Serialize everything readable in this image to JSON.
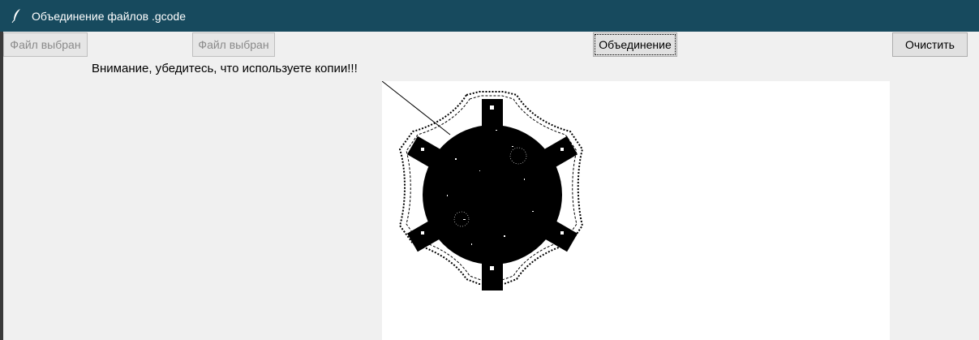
{
  "window": {
    "title": "Объединение файлов .gcode",
    "icon": "feather-icon"
  },
  "toolbar": {
    "file1_label": "Файл выбран",
    "file2_label": "Файл выбран",
    "merge_label": "Объединение",
    "clear_label": "Очистить"
  },
  "warning_text": "Внимание, убедитесь, что используете копии!!!",
  "preview": {
    "content": "gcode-toolpath-gear"
  },
  "colors": {
    "titlebar": "#174a5e",
    "background": "#f0f0f0",
    "canvas": "#ffffff",
    "toolpath": "#000000"
  }
}
